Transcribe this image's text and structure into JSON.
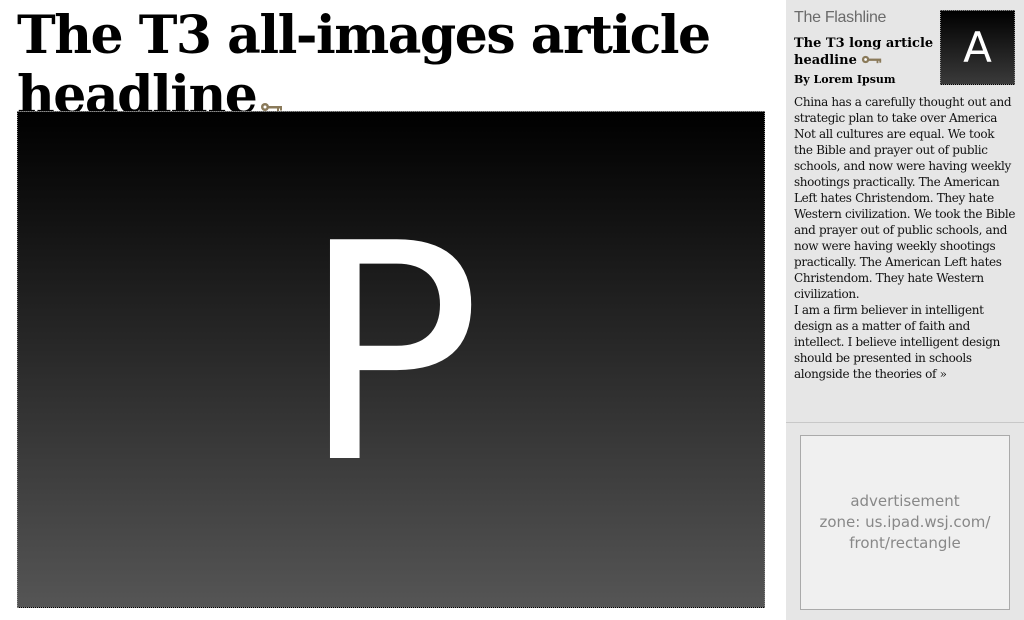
{
  "article": {
    "headline": "The T3 all-images article headline",
    "image_letter": "P"
  },
  "sidebar": {
    "section_label": "The Flashline",
    "thumb_letter": "A",
    "headline": "The T3 long article headline",
    "byline": "By Lorem Ipsum",
    "paragraph_1": "China has a carefully thought out and strategic plan to take over America Not all cultures are equal. We took the Bible and prayer out of public schools, and now were having weekly shootings practically. The American Left hates Christendom. They hate Western civilization. We took the Bible and prayer out of public schools, and now were having weekly shootings practically. The American Left hates Christendom. They hate Western civilization.",
    "paragraph_2": "I am a firm believer in intelligent design as a matter of faith and intellect. I believe intelligent design should be presented in schools alongside the theories of »"
  },
  "ad": {
    "line_1": "advertisement",
    "line_2": "zone: us.ipad.wsj.com/",
    "line_3": "front/rectangle"
  },
  "colors": {
    "key_icon": "#8a7a5a",
    "sidebar_bg": "#e6e6e6"
  },
  "icons": {
    "premium": "key-icon"
  }
}
